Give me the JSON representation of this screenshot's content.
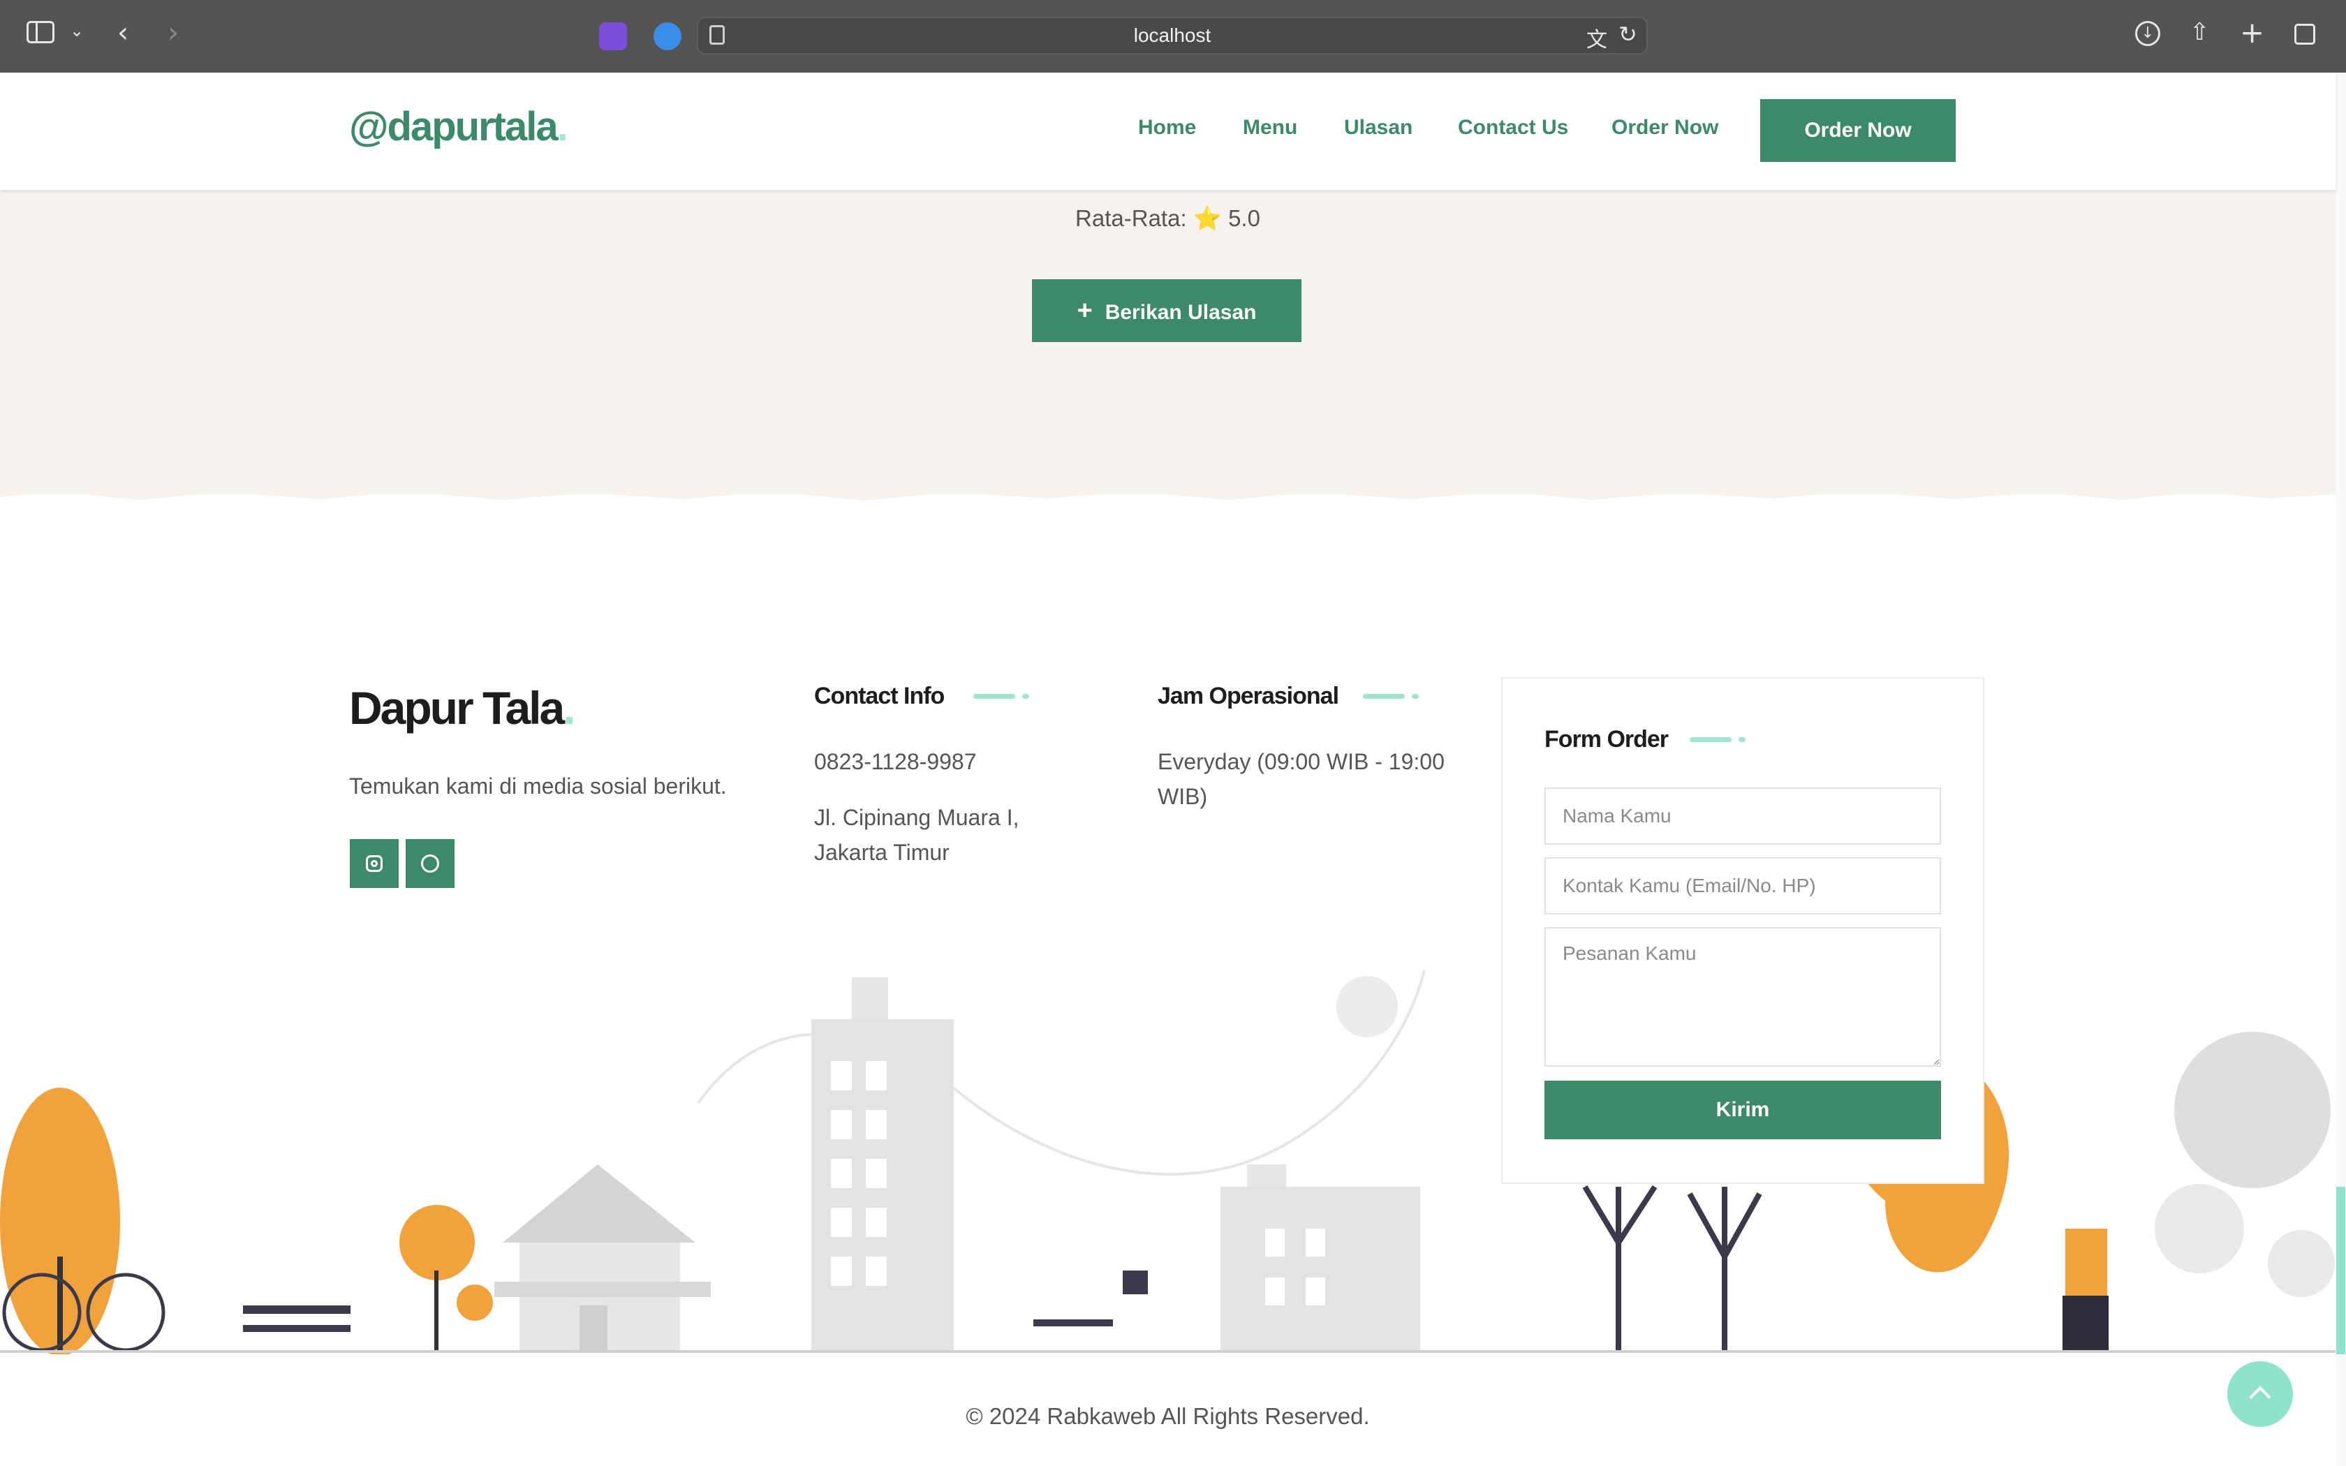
{
  "browser": {
    "url": "localhost",
    "icons": [
      "sidebar-toggle-icon",
      "chevron-down-icon",
      "back-icon",
      "forward-icon",
      "extension-icon",
      "extension-shield-icon",
      "page-icon",
      "translate-icon",
      "reload-icon",
      "download-icon",
      "share-icon",
      "new-tab-icon",
      "tab-overview-icon"
    ]
  },
  "header": {
    "logo": "@dapurtala",
    "logo_dot": ".",
    "nav": [
      "Home",
      "Menu",
      "Ulasan",
      "Contact Us",
      "Order Now"
    ],
    "cta": "Order Now"
  },
  "reviews": {
    "average_label": "Rata-Rata:",
    "average_icon": "⭐",
    "average_value": "5.0",
    "add_icon": "+",
    "add_button": "Berikan Ulasan"
  },
  "footer": {
    "brand": "Dapur Tala",
    "brand_dot": ".",
    "tagline": "Temukan kami di media sosial berikut.",
    "social": [
      "instagram-icon",
      "whatsapp-icon"
    ],
    "contact": {
      "heading": "Contact Info",
      "phone": "0823-1128-9987",
      "address_line1": "Jl. Cipinang Muara I,",
      "address_line2": "Jakarta Timur"
    },
    "hours": {
      "heading": "Jam Operasional",
      "line1": "Everyday (09:00 WIB - 19:00",
      "line2": "WIB)"
    },
    "form": {
      "heading": "Form Order",
      "name_placeholder": "Nama Kamu",
      "contact_placeholder": "Kontak Kamu (Email/No. HP)",
      "message_placeholder": "Pesanan Kamu",
      "submit": "Kirim"
    },
    "copyright": "© 2024 Rabkaweb All Rights Reserved."
  },
  "colors": {
    "brand_green": "#3d8a6a",
    "accent_mint": "#9ee6cd",
    "review_bg": "#f6f3ee",
    "illustration_orange": "#f2a23c",
    "illustration_gray": "#e6e6e6"
  }
}
